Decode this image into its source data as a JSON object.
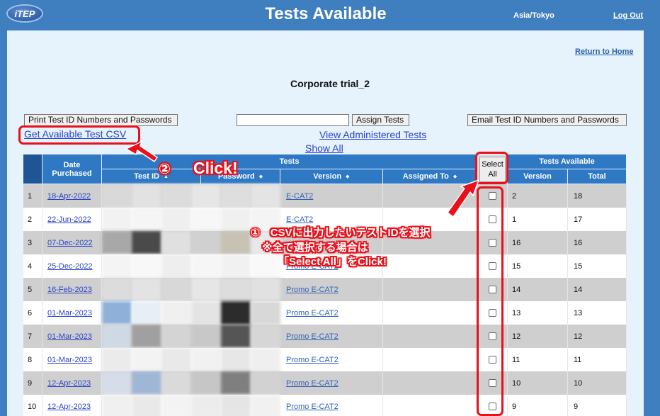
{
  "header": {
    "logo_text": "iTEP",
    "title": "Tests Available",
    "timezone": "Asia/Tokyo",
    "logout_label": "Log Out"
  },
  "nav": {
    "return_home": "Return to Home"
  },
  "trial_title": "Corporate trial_2",
  "toolbar": {
    "print_label": "Print Test ID Numbers and Passwords",
    "assign_value": "",
    "assign_label": "Assign Tests",
    "email_label": "Email Test ID Numbers and Passwords",
    "csv_label": "Get Available Test CSV",
    "view_admin_label": "View Administered Tests",
    "show_all_label": "Show All"
  },
  "table": {
    "group_headers": {
      "tests": "Tests",
      "tests_available": "Tests Available"
    },
    "headers": {
      "date_purchased": "Date Purchased",
      "test_id": "Test ID",
      "password": "Password",
      "version": "Version",
      "assigned_to": "Assigned To",
      "select_all": "Select All",
      "avail_version": "Version",
      "total": "Total"
    },
    "rows": [
      {
        "n": "1",
        "date": "18-Apr-2022",
        "version": "E-CAT2",
        "assigned": "",
        "tver": "2",
        "total": "18"
      },
      {
        "n": "2",
        "date": "22-Jun-2022",
        "version": "E-CAT2",
        "assigned": "",
        "tver": "1",
        "total": "17"
      },
      {
        "n": "3",
        "date": "07-Dec-2022",
        "version": "",
        "assigned": "",
        "tver": "16",
        "total": "16"
      },
      {
        "n": "4",
        "date": "25-Dec-2022",
        "version": "Promo E-CAT2",
        "assigned": "",
        "tver": "15",
        "total": "15"
      },
      {
        "n": "5",
        "date": "16-Feb-2023",
        "version": "Promo E-CAT2",
        "assigned": "",
        "tver": "14",
        "total": "14"
      },
      {
        "n": "6",
        "date": "01-Mar-2023",
        "version": "Promo E-CAT2",
        "assigned": "",
        "tver": "13",
        "total": "13"
      },
      {
        "n": "7",
        "date": "01-Mar-2023",
        "version": "Promo E-CAT2",
        "assigned": "",
        "tver": "12",
        "total": "12"
      },
      {
        "n": "8",
        "date": "01-Mar-2023",
        "version": "Promo E-CAT2",
        "assigned": "",
        "tver": "11",
        "total": "11"
      },
      {
        "n": "9",
        "date": "12-Apr-2023",
        "version": "Promo E-CAT2",
        "assigned": "",
        "tver": "10",
        "total": "10"
      },
      {
        "n": "10",
        "date": "12-Apr-2023",
        "version": "Promo E-CAT2",
        "assigned": "",
        "tver": "9",
        "total": "9"
      }
    ]
  },
  "annotations": {
    "step2_number": "②",
    "step2_text": "Click!",
    "step1_text": "①　CSVに出力したいテストIDを選択",
    "note_text": "※全て選択する場合は",
    "select_all_text": "「Select All」をClick!",
    "color": "#e8101a"
  }
}
